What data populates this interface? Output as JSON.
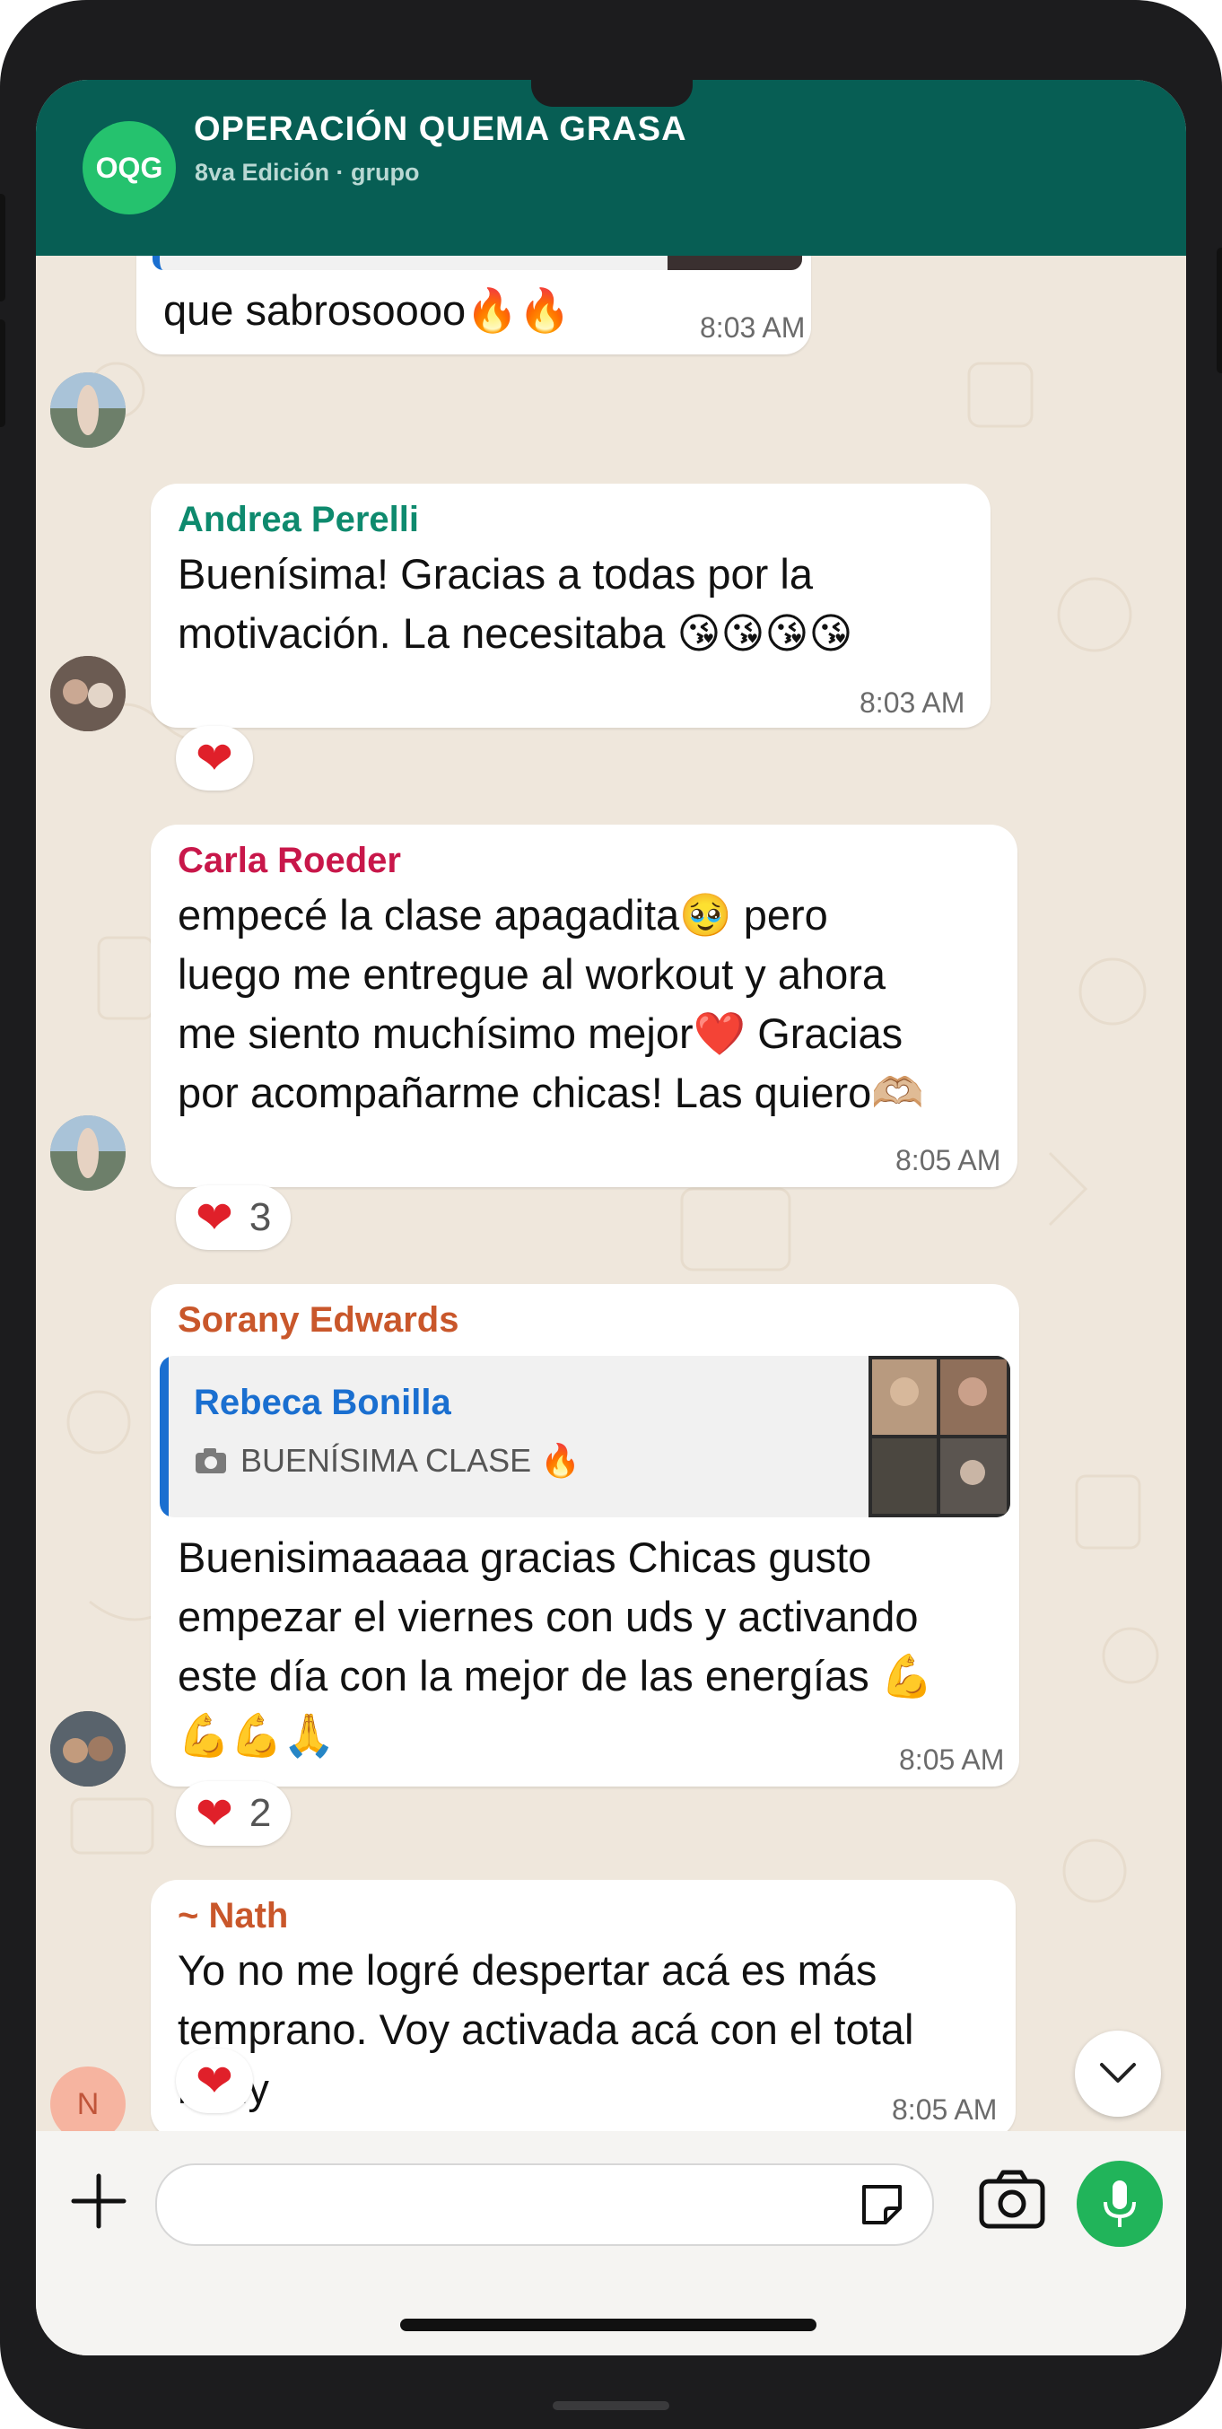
{
  "header": {
    "avatar_initials": "OQG",
    "title": "OPERACIÓN QUEMA GRASA",
    "subtitle": "8va Edición  ·  grupo"
  },
  "messages": [
    {
      "sender": "",
      "text": "que sabrosoooo🔥🔥",
      "time": "8:03 AM"
    },
    {
      "sender": "Andrea Perelli",
      "sender_color": "#0e8a6e",
      "text": "Buenísima! Gracias a todas por la\nmotivación. La necesitaba 😘😘😘😘",
      "time": "8:03 AM",
      "reaction": {
        "emoji": "❤",
        "count": ""
      }
    },
    {
      "sender": "Carla Roeder",
      "sender_color": "#c8174a",
      "text": "empecé la clase apagadita🥹 pero\nluego me entregue al workout y ahora\nme siento muchísimo mejor❤️ Gracias\npor acompañarme chicas! Las quiero🫶🏼",
      "time": "8:05 AM",
      "reaction": {
        "emoji": "❤",
        "count": "3"
      }
    },
    {
      "sender": "Sorany Edwards",
      "sender_color": "#c9572b",
      "quote": {
        "name": "Rebeca Bonilla",
        "text": "BUENÍSIMA CLASE 🔥"
      },
      "text": "Buenisimaaaaa gracias Chicas gusto\nempezar el viernes con uds y activando\neste día con la mejor de las energías 💪\n💪💪🙏",
      "time": "8:05 AM",
      "reaction": {
        "emoji": "❤",
        "count": "2"
      }
    },
    {
      "sender": "~ Nath",
      "sender_color": "#c9572b",
      "avatar_letter": "N",
      "text": "Yo no me logré despertar acá es más\ntemprano. Voy activada acá con el total\nbody",
      "time": "8:05 AM",
      "reaction": {
        "emoji": "❤",
        "count": ""
      }
    }
  ],
  "input": {
    "placeholder": ""
  },
  "colors": {
    "header_bg": "#075e54",
    "chat_bg": "#efe7dc",
    "mic_button": "#21b45a"
  },
  "icons": [
    "plus-icon",
    "sticker-icon",
    "camera-icon",
    "microphone-icon",
    "chevron-down-icon",
    "camera-small-icon"
  ]
}
